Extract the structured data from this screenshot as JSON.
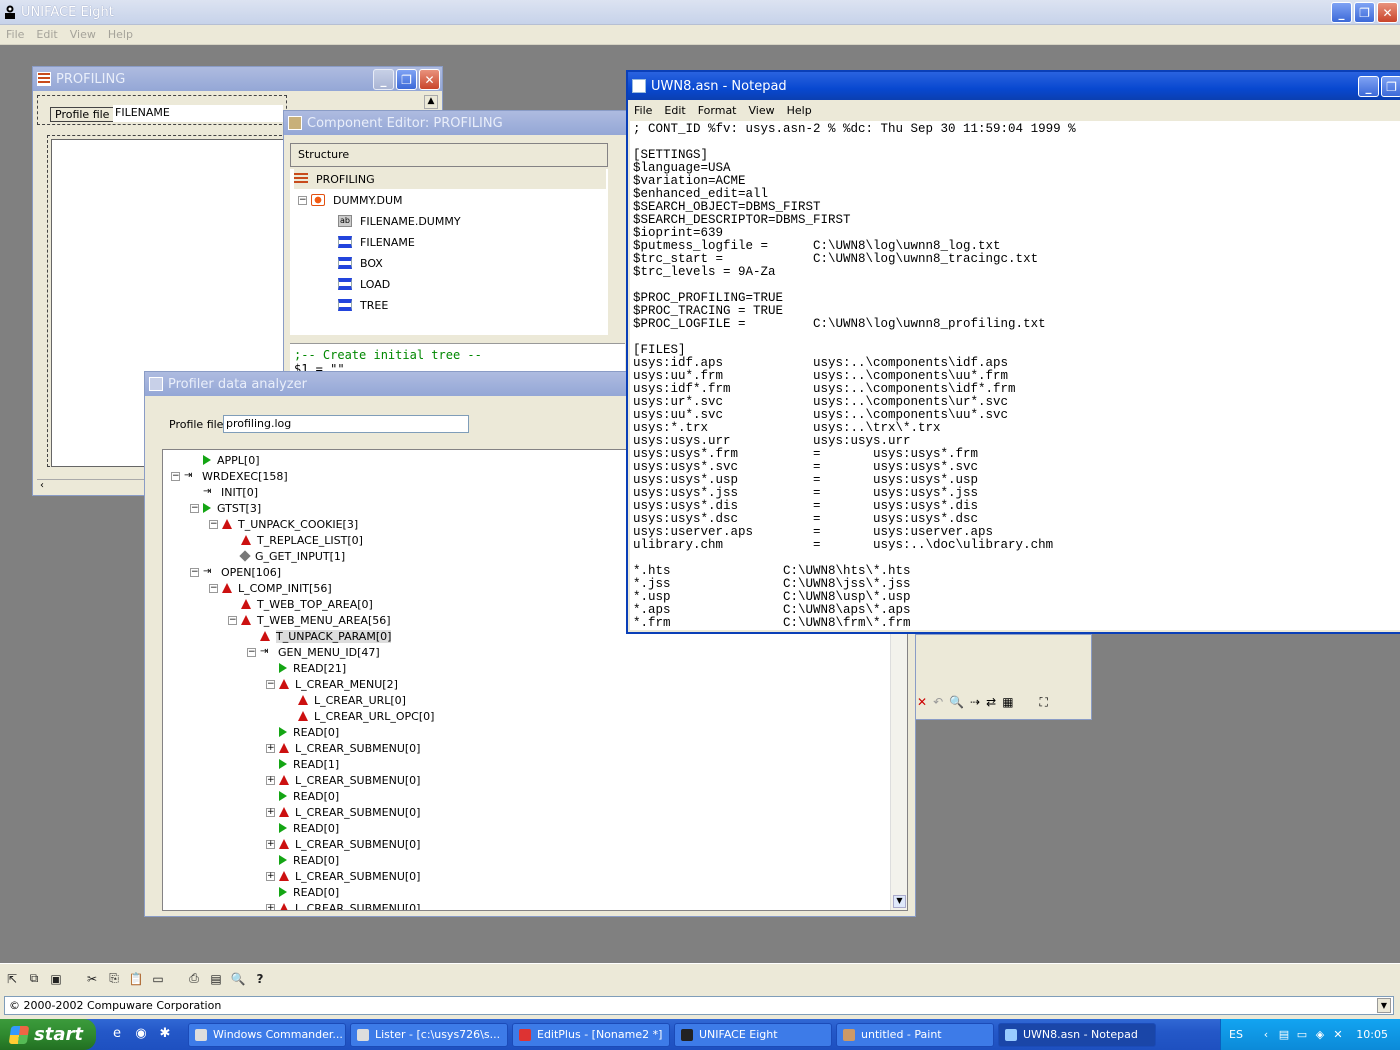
{
  "app": {
    "title": "UNIFACE Eight",
    "menu": [
      "File",
      "Edit",
      "View",
      "Help"
    ],
    "window_buttons": {
      "minimize": "_",
      "restore": "❐",
      "close": "✕"
    }
  },
  "profiling_window": {
    "title": "PROFILING",
    "profile_label": "Profile file :",
    "profile_value": "FILENAME"
  },
  "component_editor": {
    "title": "Component Editor: PROFILING",
    "structure_header": "Structure",
    "items": [
      {
        "label": "PROFILING",
        "icon": "list-icon"
      },
      {
        "label": "DUMMY.DUM",
        "icon": "entity-icon"
      },
      {
        "label": "FILENAME.DUMMY",
        "icon": "abc-field-icon"
      },
      {
        "label": "FILENAME",
        "icon": "field-icon"
      },
      {
        "label": "BOX",
        "icon": "field-icon"
      },
      {
        "label": "LOAD",
        "icon": "field-icon"
      },
      {
        "label": "TREE",
        "icon": "field-icon"
      }
    ],
    "code_lines": [
      ";-- Create initial tree --",
      "$1 = \"\""
    ]
  },
  "notepad": {
    "title": "UWN8.asn - Notepad",
    "menu": [
      "File",
      "Edit",
      "Format",
      "View",
      "Help"
    ],
    "lines": [
      "; CONT_ID %fv: usys.asn-2 % %dc: Thu Sep 30 11:59:04 1999 %",
      "",
      "[SETTINGS]",
      "$language=USA",
      "$variation=ACME",
      "$enhanced_edit=all",
      "$SEARCH_OBJECT=DBMS_FIRST",
      "$SEARCH_DESCRIPTOR=DBMS_FIRST",
      "$ioprint=639",
      "$putmess_logfile =      C:\\UWN8\\log\\uwnn8_log.txt",
      "$trc_start =            C:\\UWN8\\log\\uwnn8_tracingc.txt",
      "$trc_levels = 9A-Za",
      "",
      "$PROC_PROFILING=TRUE",
      "$PROC_TRACING = TRUE",
      "$PROC_LOGFILE =         C:\\UWN8\\log\\uwnn8_profiling.txt",
      "",
      "[FILES]",
      "usys:idf.aps            usys:..\\components\\idf.aps",
      "usys:uu*.frm            usys:..\\components\\uu*.frm",
      "usys:idf*.frm           usys:..\\components\\idf*.frm",
      "usys:ur*.svc            usys:..\\components\\ur*.svc",
      "usys:uu*.svc            usys:..\\components\\uu*.svc",
      "usys:*.trx              usys:..\\trx\\*.trx",
      "usys:usys.urr           usys:usys.urr",
      "usys:usys*.frm          =       usys:usys*.frm",
      "usys:usys*.svc          =       usys:usys*.svc",
      "usys:usys*.usp          =       usys:usys*.usp",
      "usys:usys*.jss          =       usys:usys*.jss",
      "usys:usys*.dis          =       usys:usys*.dis",
      "usys:usys*.dsc          =       usys:usys*.dsc",
      "usys:userver.aps        =       usys:userver.aps",
      "ulibrary.chm            =       usys:..\\doc\\ulibrary.chm",
      "",
      "*.hts               C:\\UWN8\\hts\\*.hts",
      "*.jss               C:\\UWN8\\jss\\*.jss",
      "*.usp               C:\\UWN8\\usp\\*.usp",
      "*.aps               C:\\UWN8\\aps\\*.aps",
      "*.frm               C:\\UWN8\\frm\\*.frm"
    ]
  },
  "profiler": {
    "title": "Profiler data analyzer",
    "profile_label": "Profile file :",
    "profile_value": "profiling.log",
    "tree": [
      {
        "label": "APPL[0]",
        "level": 1,
        "icon": "play",
        "exp": ""
      },
      {
        "label": "WRDEXEC[158]",
        "level": 0,
        "icon": "arrowlist",
        "exp": "-"
      },
      {
        "label": "INIT[0]",
        "level": 1,
        "icon": "arrowlist",
        "exp": ""
      },
      {
        "label": "GTST[3]",
        "level": 1,
        "icon": "play",
        "exp": "-"
      },
      {
        "label": "T_UNPACK_COOKIE[3]",
        "level": 2,
        "icon": "red",
        "exp": "-"
      },
      {
        "label": "T_REPLACE_LIST[0]",
        "level": 3,
        "icon": "red",
        "exp": ""
      },
      {
        "label": "G_GET_INPUT[1]",
        "level": 3,
        "icon": "gray",
        "exp": ""
      },
      {
        "label": "OPEN[106]",
        "level": 1,
        "icon": "arrowlist",
        "exp": "-"
      },
      {
        "label": "L_COMP_INIT[56]",
        "level": 2,
        "icon": "red",
        "exp": "-"
      },
      {
        "label": "T_WEB_TOP_AREA[0]",
        "level": 3,
        "icon": "red",
        "exp": ""
      },
      {
        "label": "T_WEB_MENU_AREA[56]",
        "level": 3,
        "icon": "red",
        "exp": "-"
      },
      {
        "label": "T_UNPACK_PARAM[0]",
        "level": 4,
        "icon": "red",
        "exp": "",
        "selected": true
      },
      {
        "label": "GEN_MENU_ID[47]",
        "level": 4,
        "icon": "arrowlist",
        "exp": "-"
      },
      {
        "label": "READ[21]",
        "level": 5,
        "icon": "play",
        "exp": ""
      },
      {
        "label": "L_CREAR_MENU[2]",
        "level": 5,
        "icon": "red",
        "exp": "-"
      },
      {
        "label": "L_CREAR_URL[0]",
        "level": 6,
        "icon": "red",
        "exp": ""
      },
      {
        "label": "L_CREAR_URL_OPC[0]",
        "level": 6,
        "icon": "red",
        "exp": ""
      },
      {
        "label": "READ[0]",
        "level": 5,
        "icon": "play",
        "exp": ""
      },
      {
        "label": "L_CREAR_SUBMENU[0]",
        "level": 5,
        "icon": "red",
        "exp": "+"
      },
      {
        "label": "READ[1]",
        "level": 5,
        "icon": "play",
        "exp": ""
      },
      {
        "label": "L_CREAR_SUBMENU[0]",
        "level": 5,
        "icon": "red",
        "exp": "+"
      },
      {
        "label": "READ[0]",
        "level": 5,
        "icon": "play",
        "exp": ""
      },
      {
        "label": "L_CREAR_SUBMENU[0]",
        "level": 5,
        "icon": "red",
        "exp": "+"
      },
      {
        "label": "READ[0]",
        "level": 5,
        "icon": "play",
        "exp": ""
      },
      {
        "label": "L_CREAR_SUBMENU[0]",
        "level": 5,
        "icon": "red",
        "exp": "+"
      },
      {
        "label": "READ[0]",
        "level": 5,
        "icon": "play",
        "exp": ""
      },
      {
        "label": "L_CREAR_SUBMENU[0]",
        "level": 5,
        "icon": "red",
        "exp": "+"
      },
      {
        "label": "READ[0]",
        "level": 5,
        "icon": "play",
        "exp": ""
      },
      {
        "label": "L_CREAR_SUBMENU[0]",
        "level": 5,
        "icon": "red",
        "exp": "+"
      }
    ]
  },
  "status": {
    "text": "© 2000-2002 Compuware Corporation"
  },
  "taskbar": {
    "start_label": "start",
    "tasks": [
      {
        "label": "Windows Commander...",
        "active": false
      },
      {
        "label": "Lister - [c:\\usys726\\s...",
        "active": false
      },
      {
        "label": "EditPlus - [Noname2 *]",
        "active": false
      },
      {
        "label": "UNIFACE Eight",
        "active": false
      },
      {
        "label": "untitled - Paint",
        "active": false
      },
      {
        "label": "UWN8.asn - Notepad",
        "active": true
      }
    ],
    "language": "ES",
    "clock": "10:05"
  }
}
